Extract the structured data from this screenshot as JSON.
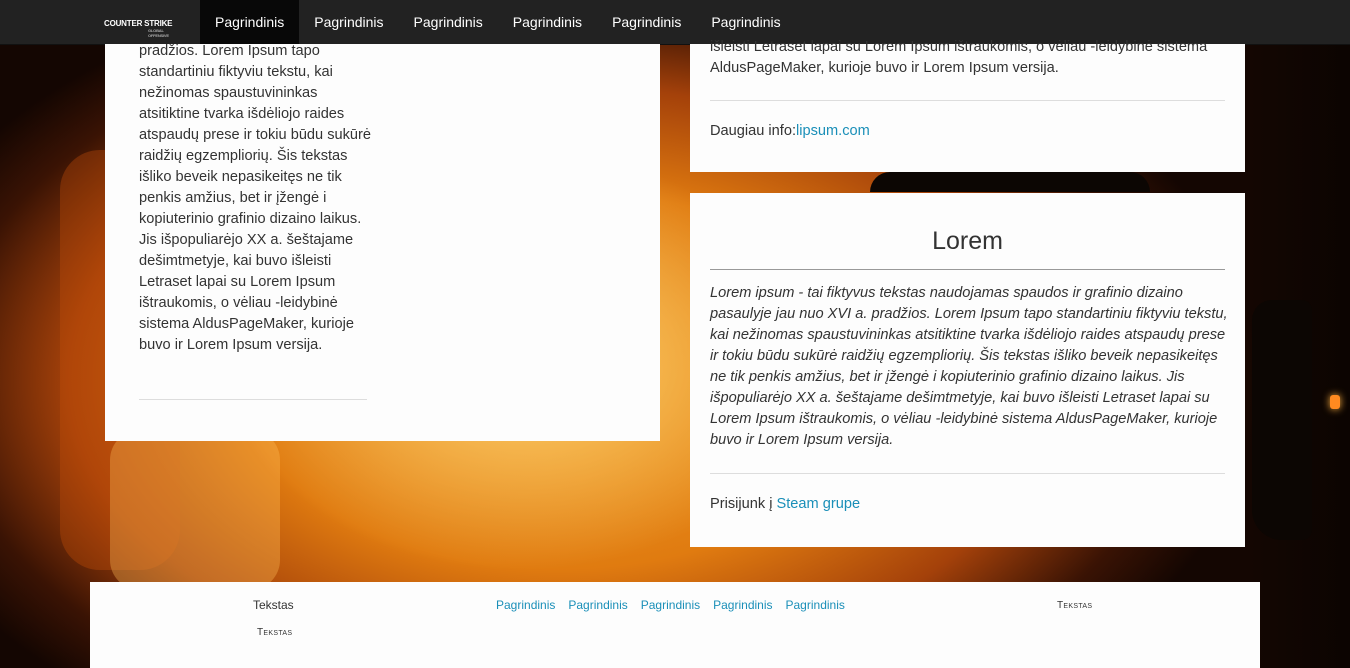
{
  "nav": {
    "brand_text": "COUNTER STRIKE",
    "brand_sub": "GLOBAL OFFENSIVE",
    "items": [
      "Pagrindinis",
      "Pagrindinis",
      "Pagrindinis",
      "Pagrindinis",
      "Pagrindinis",
      "Pagrindinis"
    ]
  },
  "left_panel": {
    "text": "pradžios. Lorem Ipsum tapo standartiniu fiktyviu tekstu, kai nežinomas spaustuvininkas atsitiktine tvarka išdėliojo raides atspaudų prese ir tokiu būdu sukūrė raidžių egzempliorių. Šis tekstas išliko beveik nepasikeitęs ne tik penkis amžius, bet ir įžengė i kopiuterinio grafinio dizaino laikus. Jis išpopuliarėjo XX a. šeštajame dešimtmetyje, kai buvo išleisti Letraset lapai su Lorem Ipsum ištraukomis, o vėliau -leidybinė sistema AldusPageMaker, kurioje buvo ir Lorem Ipsum versija."
  },
  "right_top_panel": {
    "text": "išleisti Letraset lapai su Lorem Ipsum ištraukomis, o vėliau -leidybinė sistema AldusPageMaker, kurioje buvo ir Lorem Ipsum versija.",
    "info_label": "Daugiau info:",
    "info_link": "lipsum.com"
  },
  "right_bottom_panel": {
    "title": "Lorem",
    "text": "Lorem ipsum - tai fiktyvus tekstas naudojamas spaudos ir grafinio dizaino pasaulyje jau nuo XVI a. pradžios. Lorem Ipsum tapo standartiniu fiktyviu tekstu, kai nežinomas spaustuvininkas atsitiktine tvarka išdėliojo raides atspaudų prese ir tokiu būdu sukūrė raidžių egzempliorių. Šis tekstas išliko beveik nepasikeitęs ne tik penkis amžius, bet ir įžengė i kopiuterinio grafinio dizaino laikus. Jis išpopuliarėjo XX a. šeštajame dešimtmetyje, kai buvo išleisti Letraset lapai su Lorem Ipsum ištraukomis, o vėliau -leidybinė sistema AldusPageMaker, kurioje buvo ir Lorem Ipsum versija.",
    "join_label": "Prisijunk į ",
    "join_link": "Steam grupe"
  },
  "footer": {
    "text1": "Tekstas",
    "text2": "Tekstas",
    "text3": "Tekstas",
    "links": [
      "Pagrindinis",
      "Pagrindinis",
      "Pagrindinis",
      "Pagrindinis",
      "Pagrindinis"
    ]
  },
  "colors": {
    "navbar": "#222222",
    "nav_active": "#080808",
    "link": "#1a8fb8",
    "panel": "#fdfdfd"
  }
}
